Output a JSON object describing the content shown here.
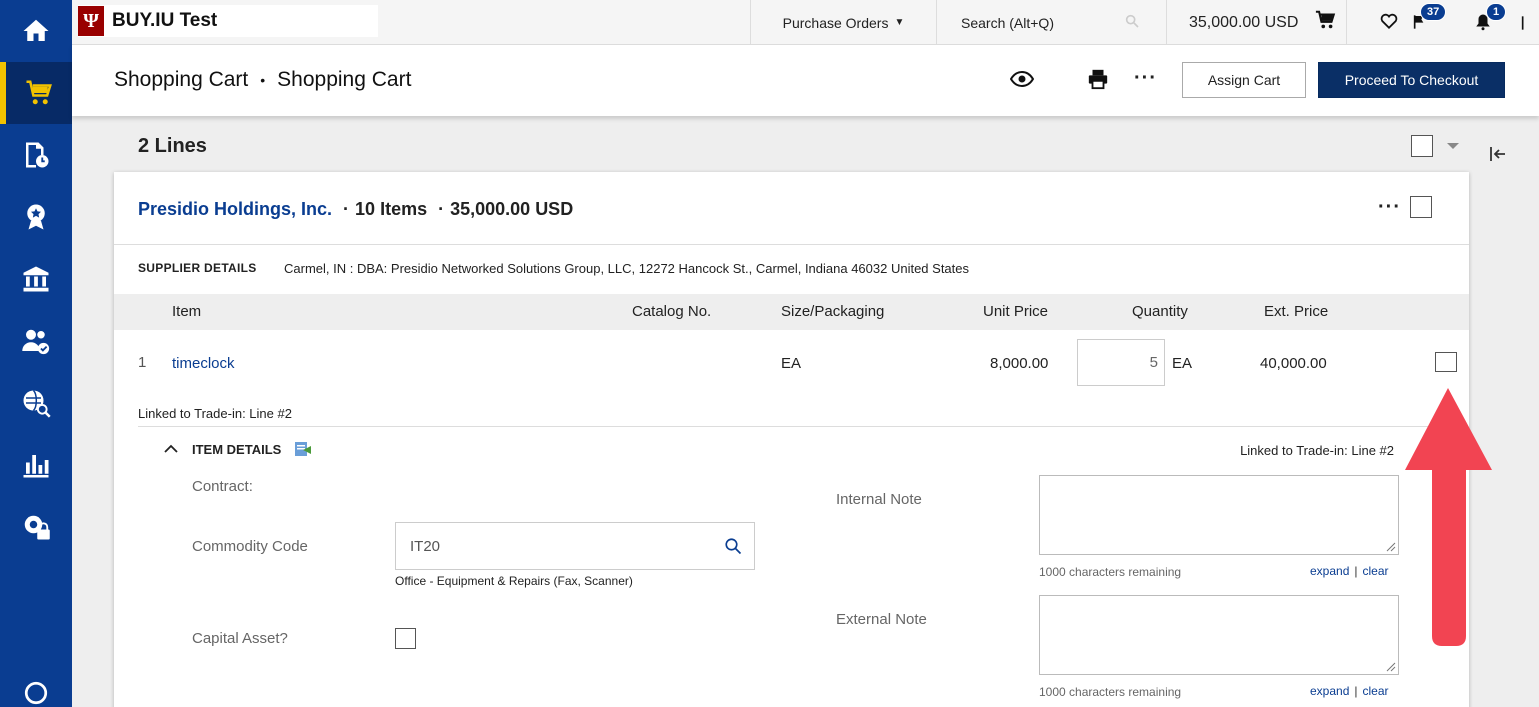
{
  "nav": {
    "items": [
      {
        "name": "home",
        "icon": "home-icon"
      },
      {
        "name": "shop",
        "icon": "shopping-cart-icon",
        "active": true
      },
      {
        "name": "orders",
        "icon": "document-clock-icon"
      },
      {
        "name": "contracts",
        "icon": "award-ribbon-icon"
      },
      {
        "name": "accounts-payable",
        "icon": "bank-icon"
      },
      {
        "name": "suppliers",
        "icon": "people-check-icon"
      },
      {
        "name": "sourcing",
        "icon": "globe-search-icon"
      },
      {
        "name": "reports",
        "icon": "bar-chart-icon"
      },
      {
        "name": "setup",
        "icon": "gear-lock-icon"
      }
    ]
  },
  "topbar": {
    "brand_logo": "Ψ",
    "brand_title": "BUY.IU Test",
    "purchase_orders": "Purchase Orders",
    "search_placeholder": "Search (Alt+Q)",
    "cart_total": "35,000.00 USD",
    "flag_badge": "37",
    "notifications_badge": "1"
  },
  "subheader": {
    "crumb_1": "Shopping Cart",
    "crumb_sep": "•",
    "crumb_2": "Shopping Cart",
    "more": "···",
    "assign_cart": "Assign Cart",
    "proceed_checkout": "Proceed To Checkout"
  },
  "main": {
    "lines_title": "2 Lines"
  },
  "supplier": {
    "name": "Presidio Holdings, Inc.",
    "dot": "·",
    "items_count": "10 Items",
    "total": "35,000.00 USD",
    "more": "···",
    "details_label": "SUPPLIER DETAILS",
    "details_value": "Carmel, IN : DBA: Presidio Networked Solutions Group, LLC, 12272 Hancock St., Carmel, Indiana 46032 United States"
  },
  "table": {
    "headers": {
      "item": "Item",
      "catalog": "Catalog No.",
      "size": "Size/Packaging",
      "unit_price": "Unit Price",
      "quantity": "Quantity",
      "ext_price": "Ext. Price"
    },
    "rows": [
      {
        "line_no": "1",
        "item": "timeclock",
        "size": "EA",
        "unit_price": "8,000.00",
        "quantity": "5",
        "uom": "EA",
        "ext_price": "40,000.00",
        "linked": "Linked to Trade-in: Line #2"
      }
    ]
  },
  "item_details": {
    "title": "ITEM DETAILS",
    "linked": "Linked to Trade-in: Line #2",
    "contract_label": "Contract:",
    "commodity_label": "Commodity Code",
    "commodity_value": "IT20",
    "commodity_desc": "Office - Equipment & Repairs (Fax, Scanner)",
    "capital_asset_label": "Capital Asset?",
    "internal_note_label": "Internal Note",
    "external_note_label": "External Note",
    "chars_remaining": "1000 characters remaining",
    "expand": "expand",
    "pipe": "|",
    "clear": "clear"
  },
  "colors": {
    "nav_bg": "#0a3d91",
    "accent_yellow": "#f2c200",
    "checkout_btn": "#0a2f66",
    "link_blue": "#0a3d91",
    "annotation_arrow": "#f24452"
  }
}
